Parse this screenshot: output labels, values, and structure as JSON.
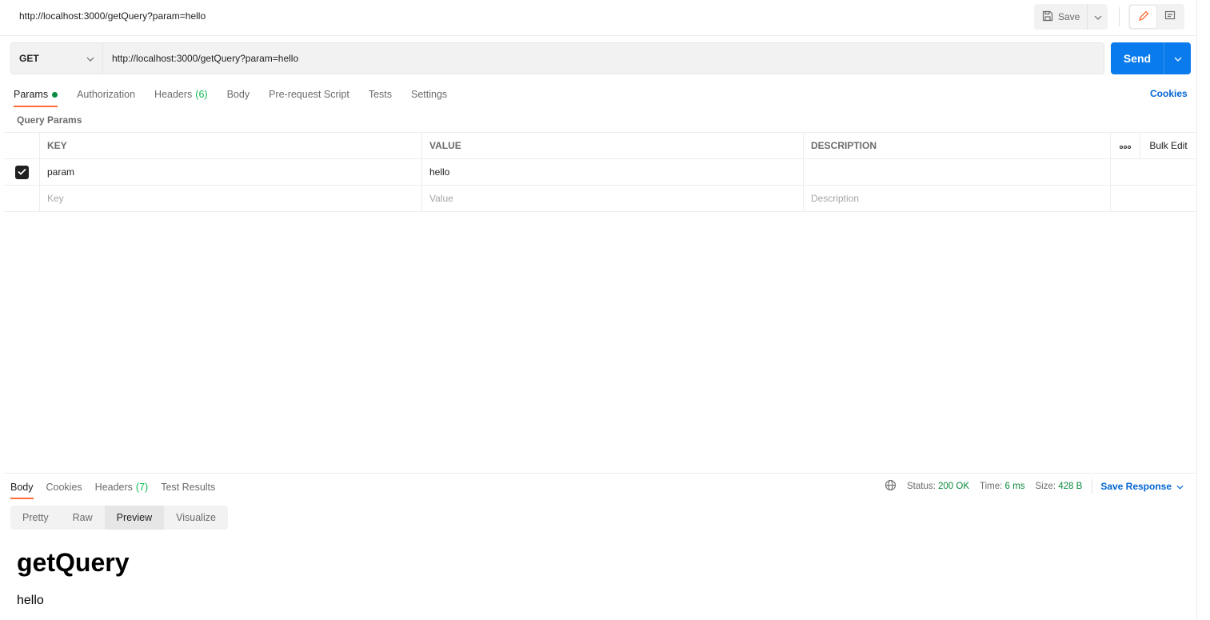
{
  "header": {
    "title": "http://localhost:3000/getQuery?param=hello",
    "save_label": "Save"
  },
  "request": {
    "method": "GET",
    "url": "http://localhost:3000/getQuery?param=hello",
    "send_label": "Send"
  },
  "tabs": [
    {
      "label": "Params"
    },
    {
      "label": "Authorization"
    },
    {
      "label": "Headers",
      "count": "(6)"
    },
    {
      "label": "Body"
    },
    {
      "label": "Pre-request Script"
    },
    {
      "label": "Tests"
    },
    {
      "label": "Settings"
    }
  ],
  "cookies_label": "Cookies",
  "query_params": {
    "title": "Query Params",
    "columns": {
      "key": "KEY",
      "value": "VALUE",
      "description": "DESCRIPTION"
    },
    "bulk_edit_label": "Bulk Edit",
    "rows": [
      {
        "key": "param",
        "value": "hello",
        "description": ""
      }
    ],
    "placeholders": {
      "key": "Key",
      "value": "Value",
      "description": "Description"
    }
  },
  "response": {
    "tabs": [
      {
        "label": "Body"
      },
      {
        "label": "Cookies"
      },
      {
        "label": "Headers",
        "count": "(7)"
      },
      {
        "label": "Test Results"
      }
    ],
    "status_label": "Status:",
    "status_value": "200 OK",
    "time_label": "Time:",
    "time_value": "6 ms",
    "size_label": "Size:",
    "size_value": "428 B",
    "save_response_label": "Save Response",
    "view_tabs": [
      "Pretty",
      "Raw",
      "Preview",
      "Visualize"
    ],
    "preview": {
      "heading": "getQuery",
      "text": "hello"
    }
  },
  "colors": {
    "accent": "#ff6c37",
    "send": "#097bed",
    "link": "#0265d2",
    "success": "#0b8a3e"
  }
}
